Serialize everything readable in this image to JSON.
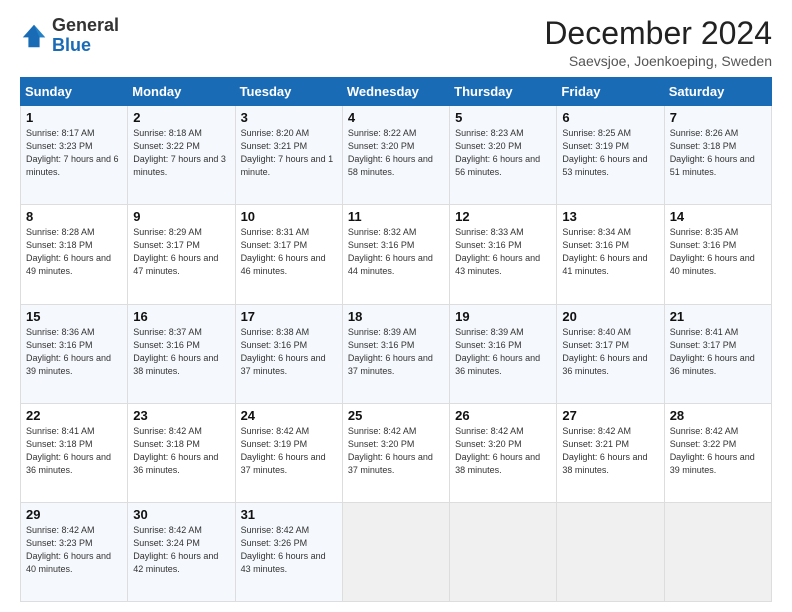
{
  "header": {
    "logo_general": "General",
    "logo_blue": "Blue",
    "month_title": "December 2024",
    "subtitle": "Saevsjoe, Joenkoeping, Sweden"
  },
  "weekdays": [
    "Sunday",
    "Monday",
    "Tuesday",
    "Wednesday",
    "Thursday",
    "Friday",
    "Saturday"
  ],
  "weeks": [
    [
      {
        "day": "1",
        "sunrise": "8:17 AM",
        "sunset": "3:23 PM",
        "daylight": "7 hours and 6 minutes."
      },
      {
        "day": "2",
        "sunrise": "8:18 AM",
        "sunset": "3:22 PM",
        "daylight": "7 hours and 3 minutes."
      },
      {
        "day": "3",
        "sunrise": "8:20 AM",
        "sunset": "3:21 PM",
        "daylight": "7 hours and 1 minute."
      },
      {
        "day": "4",
        "sunrise": "8:22 AM",
        "sunset": "3:20 PM",
        "daylight": "6 hours and 58 minutes."
      },
      {
        "day": "5",
        "sunrise": "8:23 AM",
        "sunset": "3:20 PM",
        "daylight": "6 hours and 56 minutes."
      },
      {
        "day": "6",
        "sunrise": "8:25 AM",
        "sunset": "3:19 PM",
        "daylight": "6 hours and 53 minutes."
      },
      {
        "day": "7",
        "sunrise": "8:26 AM",
        "sunset": "3:18 PM",
        "daylight": "6 hours and 51 minutes."
      }
    ],
    [
      {
        "day": "8",
        "sunrise": "8:28 AM",
        "sunset": "3:18 PM",
        "daylight": "6 hours and 49 minutes."
      },
      {
        "day": "9",
        "sunrise": "8:29 AM",
        "sunset": "3:17 PM",
        "daylight": "6 hours and 47 minutes."
      },
      {
        "day": "10",
        "sunrise": "8:31 AM",
        "sunset": "3:17 PM",
        "daylight": "6 hours and 46 minutes."
      },
      {
        "day": "11",
        "sunrise": "8:32 AM",
        "sunset": "3:16 PM",
        "daylight": "6 hours and 44 minutes."
      },
      {
        "day": "12",
        "sunrise": "8:33 AM",
        "sunset": "3:16 PM",
        "daylight": "6 hours and 43 minutes."
      },
      {
        "day": "13",
        "sunrise": "8:34 AM",
        "sunset": "3:16 PM",
        "daylight": "6 hours and 41 minutes."
      },
      {
        "day": "14",
        "sunrise": "8:35 AM",
        "sunset": "3:16 PM",
        "daylight": "6 hours and 40 minutes."
      }
    ],
    [
      {
        "day": "15",
        "sunrise": "8:36 AM",
        "sunset": "3:16 PM",
        "daylight": "6 hours and 39 minutes."
      },
      {
        "day": "16",
        "sunrise": "8:37 AM",
        "sunset": "3:16 PM",
        "daylight": "6 hours and 38 minutes."
      },
      {
        "day": "17",
        "sunrise": "8:38 AM",
        "sunset": "3:16 PM",
        "daylight": "6 hours and 37 minutes."
      },
      {
        "day": "18",
        "sunrise": "8:39 AM",
        "sunset": "3:16 PM",
        "daylight": "6 hours and 37 minutes."
      },
      {
        "day": "19",
        "sunrise": "8:39 AM",
        "sunset": "3:16 PM",
        "daylight": "6 hours and 36 minutes."
      },
      {
        "day": "20",
        "sunrise": "8:40 AM",
        "sunset": "3:17 PM",
        "daylight": "6 hours and 36 minutes."
      },
      {
        "day": "21",
        "sunrise": "8:41 AM",
        "sunset": "3:17 PM",
        "daylight": "6 hours and 36 minutes."
      }
    ],
    [
      {
        "day": "22",
        "sunrise": "8:41 AM",
        "sunset": "3:18 PM",
        "daylight": "6 hours and 36 minutes."
      },
      {
        "day": "23",
        "sunrise": "8:42 AM",
        "sunset": "3:18 PM",
        "daylight": "6 hours and 36 minutes."
      },
      {
        "day": "24",
        "sunrise": "8:42 AM",
        "sunset": "3:19 PM",
        "daylight": "6 hours and 37 minutes."
      },
      {
        "day": "25",
        "sunrise": "8:42 AM",
        "sunset": "3:20 PM",
        "daylight": "6 hours and 37 minutes."
      },
      {
        "day": "26",
        "sunrise": "8:42 AM",
        "sunset": "3:20 PM",
        "daylight": "6 hours and 38 minutes."
      },
      {
        "day": "27",
        "sunrise": "8:42 AM",
        "sunset": "3:21 PM",
        "daylight": "6 hours and 38 minutes."
      },
      {
        "day": "28",
        "sunrise": "8:42 AM",
        "sunset": "3:22 PM",
        "daylight": "6 hours and 39 minutes."
      }
    ],
    [
      {
        "day": "29",
        "sunrise": "8:42 AM",
        "sunset": "3:23 PM",
        "daylight": "6 hours and 40 minutes."
      },
      {
        "day": "30",
        "sunrise": "8:42 AM",
        "sunset": "3:24 PM",
        "daylight": "6 hours and 42 minutes."
      },
      {
        "day": "31",
        "sunrise": "8:42 AM",
        "sunset": "3:26 PM",
        "daylight": "6 hours and 43 minutes."
      },
      null,
      null,
      null,
      null
    ]
  ]
}
